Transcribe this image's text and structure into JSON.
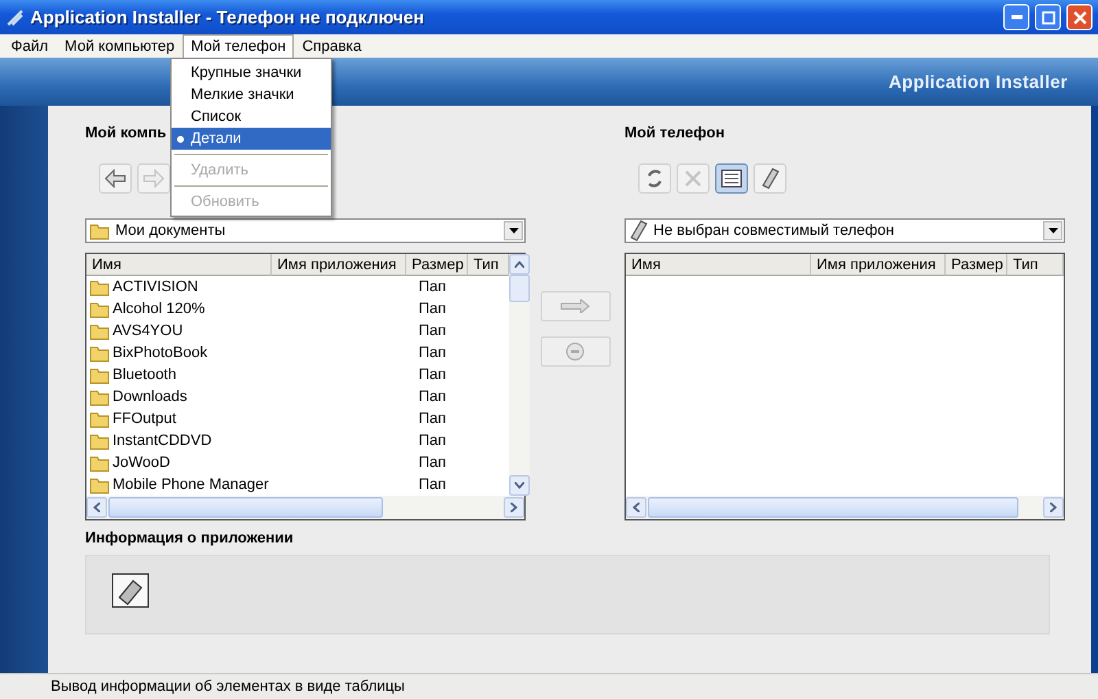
{
  "window": {
    "title": "Application Installer - Телефон не подключен"
  },
  "menu_bar": [
    {
      "label": "Файл",
      "selected": false
    },
    {
      "label": "Мой компьютер",
      "selected": false
    },
    {
      "label": "Мой телефон",
      "selected": true
    },
    {
      "label": "Справка",
      "selected": false
    }
  ],
  "open_menu": {
    "items": [
      {
        "kind": "radio",
        "label": "Крупные значки",
        "selected": false,
        "highlighted": false
      },
      {
        "kind": "radio",
        "label": "Мелкие значки",
        "selected": false,
        "highlighted": false
      },
      {
        "kind": "radio",
        "label": "Список",
        "selected": false,
        "highlighted": false
      },
      {
        "kind": "radio",
        "label": "Детали",
        "selected": true,
        "highlighted": true
      },
      {
        "kind": "separator"
      },
      {
        "kind": "item",
        "label": "Удалить",
        "disabled": true
      },
      {
        "kind": "separator"
      },
      {
        "kind": "item",
        "label": "Обновить",
        "disabled": true
      }
    ]
  },
  "banner": {
    "title": "Application Installer"
  },
  "computer_panel": {
    "heading": "Мой компь",
    "tools": [
      {
        "kind": "back",
        "disabled": false
      },
      {
        "kind": "forward",
        "disabled": true
      }
    ],
    "location": "Мои документы",
    "columns": [
      "Имя",
      "Имя приложения",
      "Размер",
      "Тип"
    ],
    "rows": [
      {
        "name": "ACTIVISION",
        "type": "Пап"
      },
      {
        "name": "Alcohol 120%",
        "type": "Пап"
      },
      {
        "name": "AVS4YOU",
        "type": "Пап"
      },
      {
        "name": "BixPhotoBook",
        "type": "Пап"
      },
      {
        "name": "Bluetooth",
        "type": "Пап"
      },
      {
        "name": "Downloads",
        "type": "Пап"
      },
      {
        "name": "FFOutput",
        "type": "Пап"
      },
      {
        "name": "InstantCDDVD",
        "type": "Пап"
      },
      {
        "name": "JoWooD",
        "type": "Пап"
      },
      {
        "name": "Mobile Phone Manager",
        "type": "Пап"
      }
    ]
  },
  "transfer_buttons": [
    {
      "kind": "send",
      "disabled": true
    },
    {
      "kind": "remove",
      "disabled": true
    }
  ],
  "phone_panel": {
    "heading": "Мой телефон",
    "tools": [
      {
        "kind": "refresh",
        "disabled": false,
        "selected": false
      },
      {
        "kind": "delete",
        "disabled": true,
        "selected": false
      },
      {
        "kind": "details",
        "disabled": false,
        "selected": true
      },
      {
        "kind": "phone",
        "disabled": false,
        "selected": false
      }
    ],
    "location": "Не выбран совместимый телефон",
    "columns": [
      "Имя",
      "Имя приложения",
      "Размер",
      "Тип"
    ]
  },
  "info": {
    "heading": "Информация о приложении"
  },
  "status_bar": "Вывод информации об элементах в виде таблицы"
}
